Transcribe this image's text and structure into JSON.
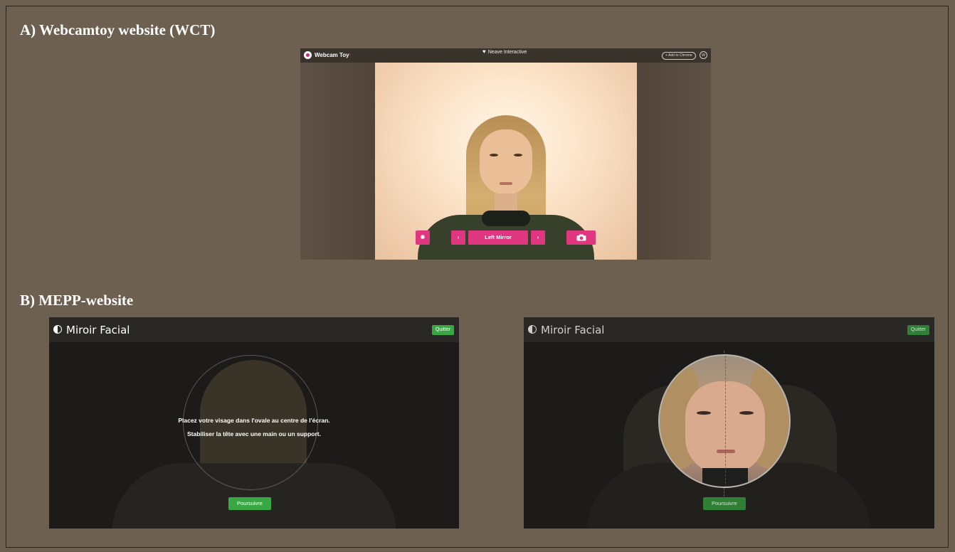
{
  "section_a": {
    "label": "A) Webcamtoy website (WCT)"
  },
  "section_b": {
    "label": "B) MEPP-website"
  },
  "webcamtoy": {
    "app_name": "Webcam Toy",
    "app_name_mark": "°",
    "header_center": "Neave Interactive",
    "add_to_chrome": "+ Add to Chrome",
    "language_button": "W",
    "effect_name": "Left Mirror",
    "icons": {
      "logo": "webcam-toy-logo-icon",
      "heart": "heart-icon",
      "settings": "gear-icon",
      "prev": "chevron-left-icon",
      "next": "chevron-right-icon",
      "camera": "camera-icon"
    },
    "accent_color": "#e0357f"
  },
  "mepp_left": {
    "brand": "Miroir Facial",
    "quit_label": "Quitter",
    "instruction_line1": "Placez votre visage dans l'ovale au centre de l'écran.",
    "instruction_line2": "Stabiliser la tête avec une main ou un support.",
    "continue_label": "Poursuivre"
  },
  "mepp_right": {
    "brand": "Miroir Facial",
    "quit_label": "Quitter",
    "continue_label": "Poursuivre"
  },
  "colors": {
    "page_bg": "#6e6050",
    "mepp_green": "#3aa745"
  }
}
